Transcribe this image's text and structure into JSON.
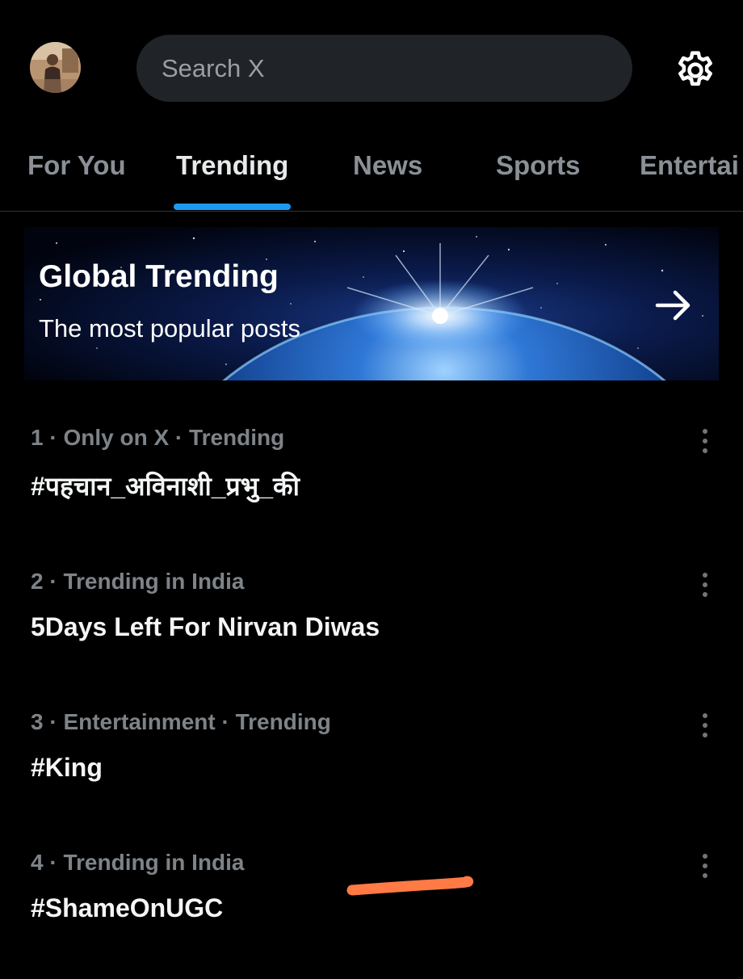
{
  "header": {
    "search_placeholder": "Search X",
    "avatar_icon": "user-avatar-photo",
    "settings_icon": "gear-icon"
  },
  "tabs": [
    {
      "label": "For You",
      "active": false
    },
    {
      "label": "Trending",
      "active": true
    },
    {
      "label": "News",
      "active": false
    },
    {
      "label": "Sports",
      "active": false
    },
    {
      "label": "Entertai",
      "active": false
    }
  ],
  "banner": {
    "title": "Global Trending",
    "subtitle": "The most popular posts",
    "arrow_icon": "arrow-right-icon"
  },
  "trends": [
    {
      "meta": "1 · Only on X · Trending",
      "title": "#पहचान_अविनाशी_प्रभु_की"
    },
    {
      "meta": "2 · Trending in India",
      "title": "5Days Left For Nirvan Diwas"
    },
    {
      "meta": "3 · Entertainment · Trending",
      "title": "#King"
    },
    {
      "meta": "4 · Trending in India",
      "title": "#ShameOnUGC"
    }
  ],
  "colors": {
    "background": "#000000",
    "accent": "#1d9bf0",
    "annotation": "#ff7a45",
    "muted_text": "#7e8388",
    "primary_text": "#e7e9ea",
    "search_bg": "#202327"
  }
}
